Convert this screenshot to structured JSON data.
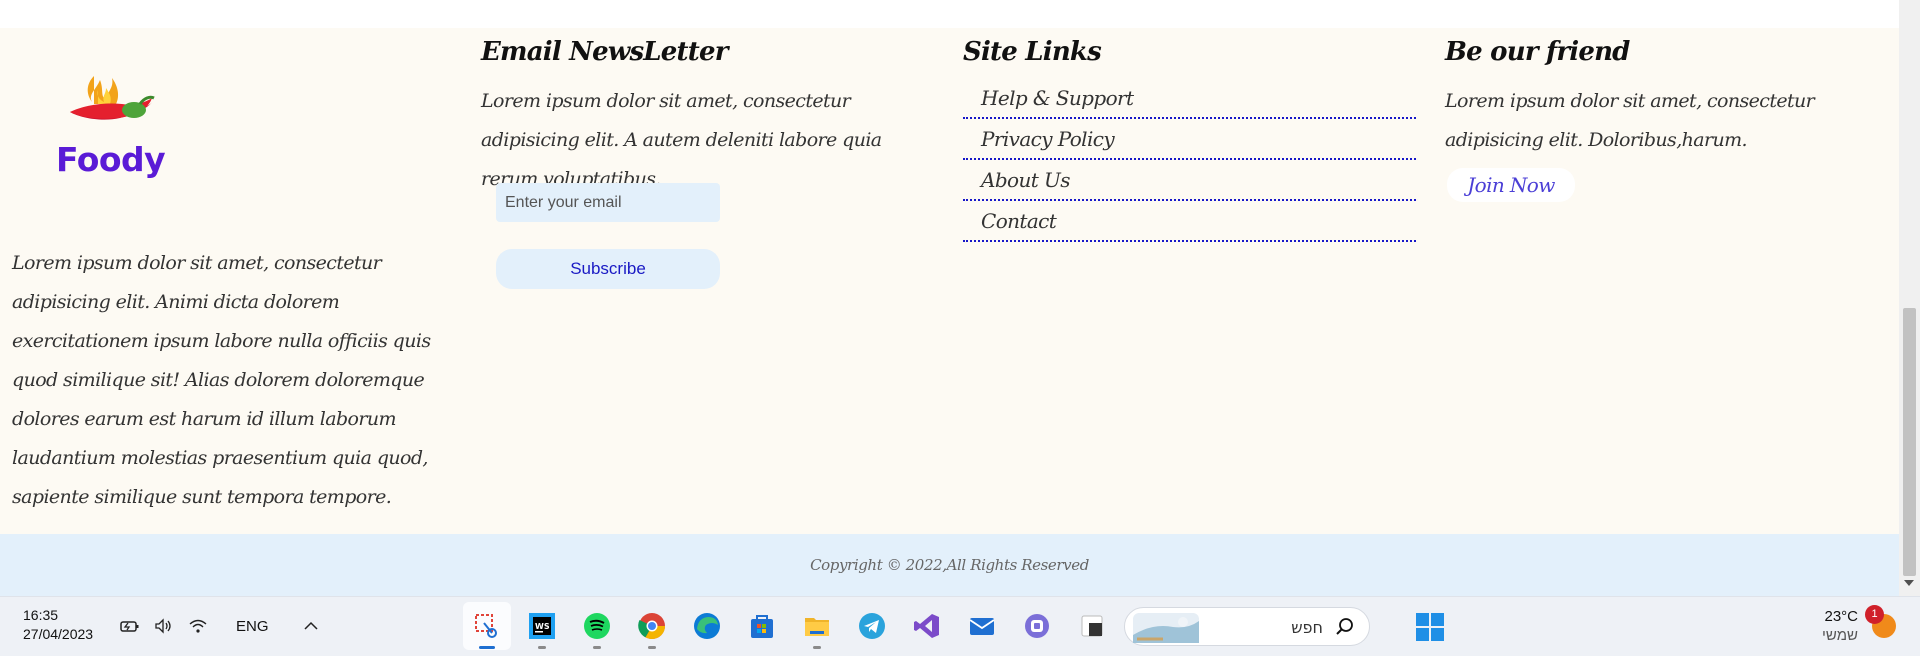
{
  "brand": {
    "logo_text": "Foody"
  },
  "about": {
    "text": "Lorem ipsum dolor sit amet, consectetur adipisicing elit. Animi dicta dolorem exercitationem ipsum labore nulla officiis quis quod similique sit! Alias dolorem doloremque dolores earum est harum id illum laborum laudantium molestias praesentium quia quod, sapiente similique sunt tempora tempore."
  },
  "newsletter": {
    "heading": "Email NewsLetter",
    "text": "Lorem ipsum dolor sit amet, consectetur adipisicing elit. A autem deleniti labore quia rerum voluptatibus.",
    "email_placeholder": "Enter your email",
    "email_value": "",
    "subscribe_label": "Subscribe"
  },
  "site_links": {
    "heading": "Site Links",
    "items": [
      {
        "label": "Help & Support"
      },
      {
        "label": "Privacy Policy"
      },
      {
        "label": "About Us"
      },
      {
        "label": "Contact"
      }
    ]
  },
  "friend": {
    "heading": "Be our friend",
    "text": "Lorem ipsum dolor sit amet, consectetur adipisicing elit. Doloribus,harum.",
    "join_label": "Join Now"
  },
  "copyright": {
    "text": "Copyright © 2022,All Rights Reserved"
  },
  "taskbar": {
    "time": "16:35",
    "date": "27/04/2023",
    "language": "ENG",
    "search_text": "חפש",
    "weather_temp": "23°C",
    "weather_desc": "שמשי",
    "notification_count": "1",
    "apps": [
      {
        "name": "snipping-tool"
      },
      {
        "name": "webstorm"
      },
      {
        "name": "spotify"
      },
      {
        "name": "chrome"
      },
      {
        "name": "edge"
      },
      {
        "name": "microsoft-store"
      },
      {
        "name": "file-explorer"
      },
      {
        "name": "telegram"
      },
      {
        "name": "visual-studio"
      },
      {
        "name": "mail"
      },
      {
        "name": "teams"
      },
      {
        "name": "terminal"
      }
    ]
  },
  "colors": {
    "footer_bg": "#fdfaf3",
    "copyright_bg": "#e3f0fb",
    "brand_purple": "#5a1bd6",
    "link_underline": "#1717c8",
    "subscribe_text": "#1a1ac4"
  }
}
